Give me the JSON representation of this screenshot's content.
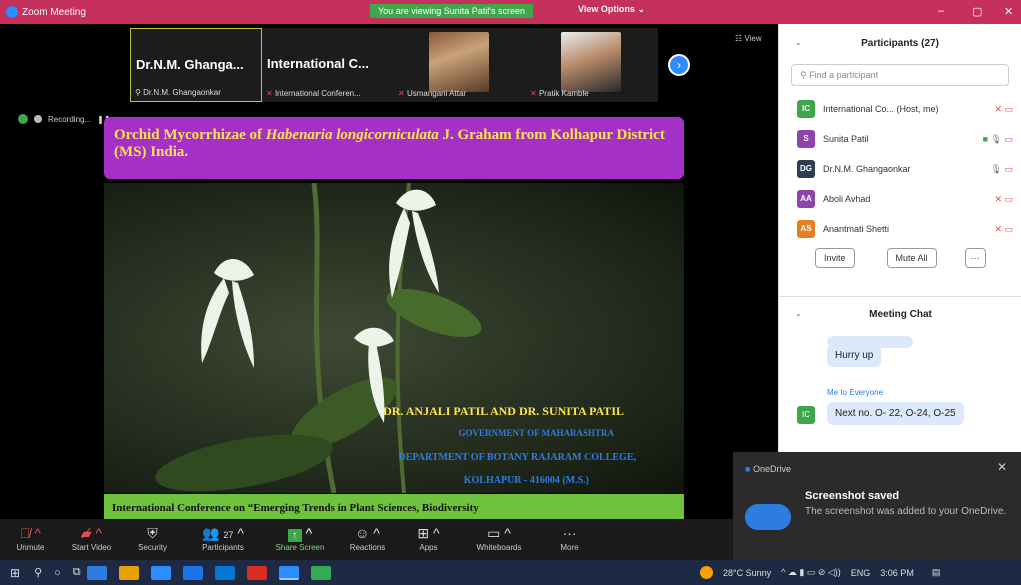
{
  "titlebar": {
    "app": "Zoom Meeting",
    "viewing": "You are viewing Sunita Patil's screen",
    "view_options": "View Options",
    "minimize": "–",
    "maximize": "▢",
    "close": "✕"
  },
  "gallery": {
    "view_label": "View",
    "thumbs": [
      {
        "big": "Dr.N.M. Ghanga...",
        "label": "Dr.N.M. Ghangaonkar"
      },
      {
        "big": "International C...",
        "label": "International Conferen..."
      },
      {
        "label": "Usmangani Attar"
      },
      {
        "label": "Pratik Kamble"
      }
    ]
  },
  "recording": "Recording...",
  "slide": {
    "title_pre": "Orchid Mycorrhizae of ",
    "title_italic": "Habenaria longicorniculata",
    "title_post": " J. Graham from Kolhapur District (MS) India.",
    "authors": "DR. ANJALI PATIL AND DR. SUNITA PATIL",
    "gov": "GOVERNMENT OF MAHARASHTRA",
    "dept": "DEPARTMENT OF BOTANY RAJARAM COLLEGE,",
    "city": "KOLHAPUR - 416004 (M.S.)",
    "conference": "International Conference on “Emerging Trends in Plant Sciences, Biodiversity"
  },
  "toolbar": {
    "unmute": "Unmute",
    "start_video": "Start Video",
    "security": "Security",
    "participants": "Participants",
    "participants_count": "27",
    "share": "Share Screen",
    "reactions": "Reactions",
    "apps": "Apps",
    "whiteboards": "Whiteboards",
    "more": "More"
  },
  "participants_panel": {
    "title": "Participants (27)",
    "search_placeholder": "Find a participant",
    "people": [
      {
        "initials": "IC",
        "name": "International Co... (Host, me)",
        "color": "#3fa64a"
      },
      {
        "initials": "S",
        "name": "Sunita Patil",
        "color": "#8e44ad"
      },
      {
        "initials": "DG",
        "name": "Dr.N.M. Ghangaonkar",
        "color": "#2c3e50"
      },
      {
        "initials": "AA",
        "name": "Aboli Avhad",
        "color": "#8e44ad"
      },
      {
        "initials": "AS",
        "name": "Anantmati Shetti",
        "color": "#e67e22"
      }
    ],
    "invite": "Invite",
    "mute_all": "Mute All",
    "more": "···"
  },
  "chat": {
    "title": "Meeting Chat",
    "msg1": "Hurry up",
    "sender": "Me to Everyone",
    "sender_initials": "IC",
    "msg2": "Next no. O- 22, O-24, O-25"
  },
  "toast": {
    "app": "OneDrive",
    "title": "Screenshot saved",
    "body": "The screenshot was added to your OneDrive."
  },
  "taskbar": {
    "weather": "28°C Sunny",
    "lang": "ENG",
    "time": "3:06 PM"
  }
}
